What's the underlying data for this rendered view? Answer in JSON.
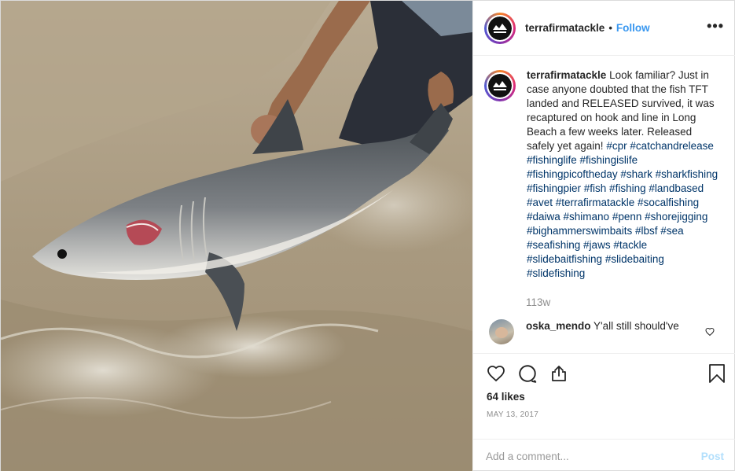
{
  "header": {
    "username": "terrafirmatackle",
    "separator": "•",
    "follow_label": "Follow",
    "more_label": "•••"
  },
  "logo": {
    "top_text": "TERRA FIRMA",
    "bottom_text": "TACKLE"
  },
  "caption": {
    "username": "terrafirmatackle",
    "text": "Look familiar? Just in case anyone doubted that the fish TFT landed and RELEASED survived, it was recaptured on hook and line in Long Beach a few weeks later. Released safely yet again!",
    "hashtags": "#cpr #catchandrelease #fishinglife #fishingislife #fishingpicoftheday #shark #sharkfishing #fishingpier #fish #fishing #landbased #avet #terrafirmatackle #socalfishing #daiwa #shimano #penn #shorejigging #bighammerswimbaits #lbsf #sea #seafishing #jaws #tackle #slidebaitfishing #slidebaiting #slidefishing",
    "time": "113w"
  },
  "comment": {
    "username": "oska_mendo",
    "text": "Y'all still should've"
  },
  "actions": {
    "likes": "64 likes",
    "date": "MAY 13, 2017"
  },
  "add_comment": {
    "placeholder": "Add a comment...",
    "post_label": "Post"
  },
  "icons": {
    "like": "heart-icon",
    "comment": "comment-bubble-icon",
    "share": "share-icon",
    "save": "bookmark-icon"
  },
  "colors": {
    "follow": "#3897f0",
    "hashtag": "#003569",
    "muted": "#8e8e8e",
    "post_disabled": "#b2dffc"
  }
}
